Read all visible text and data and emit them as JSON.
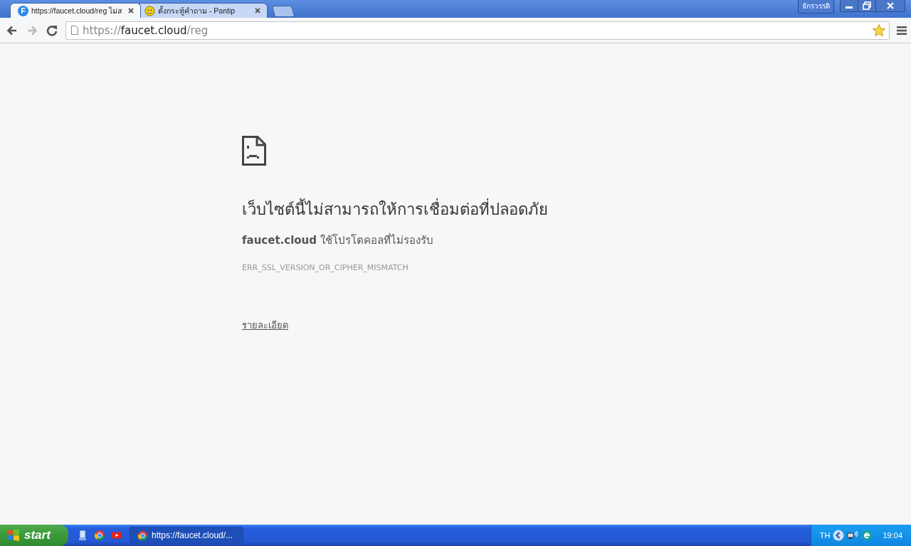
{
  "tabs": [
    {
      "title": "https://faucet.cloud/reg ไม่ส",
      "kind": "letter",
      "glyph": "F",
      "selected": true
    },
    {
      "title": "ตั้งกระทู้คำถาม - Pantip",
      "kind": "smiley",
      "selected": false
    }
  ],
  "profile": "จักรวรรดิ",
  "address_bar": {
    "scheme": "https://",
    "host": "faucet.cloud",
    "path": "/reg",
    "bookmarked": true
  },
  "error_page": {
    "heading": "เว็บไซต์นี้ไม่สามารถให้การเชื่อมต่อที่ปลอดภัย",
    "message": "**faucet.cloud** ใช้โปรโตคอลที่ไม่รองรับ",
    "code": "ERR_SSL_VERSION_OR_CIPHER_MISMATCH",
    "details_link": "รายละเอียด"
  },
  "taskbar": {
    "start": "start",
    "quick_launch": [
      {
        "kind": "desktop"
      },
      {
        "kind": "chrome"
      },
      {
        "kind": "youtube"
      }
    ],
    "tasks": [
      {
        "title": "https://faucet.cloud/...",
        "selected": true
      }
    ],
    "language": "TH",
    "time": "19:04"
  }
}
